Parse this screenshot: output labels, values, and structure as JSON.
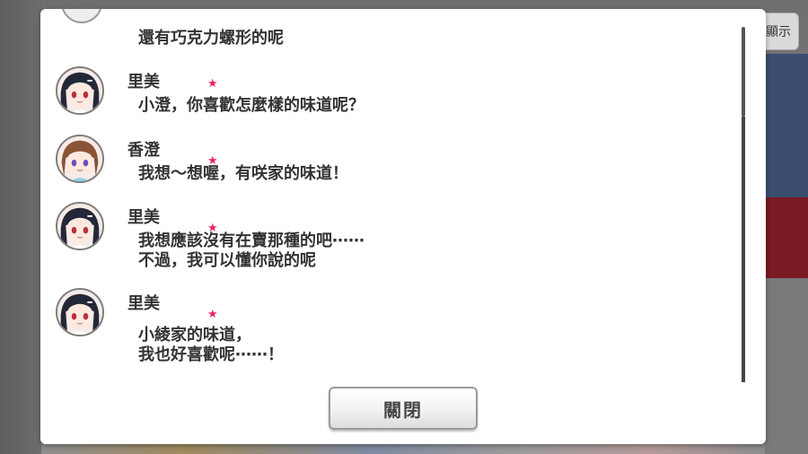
{
  "hint_button": {
    "label": "顯示"
  },
  "dialog": {
    "entries": [
      {
        "speaker": "",
        "lines": [
          "還有巧克力螺形的呢"
        ],
        "avatar": "partial-avatar"
      },
      {
        "speaker": "里美",
        "lines": [
          "小澄，你喜歡怎麼樣的味道呢？"
        ],
        "avatar": "rimi-avatar",
        "star": "★"
      },
      {
        "speaker": "香澄",
        "lines": [
          "我想～想喔，有咲家的味道！"
        ],
        "avatar": "kasumi-avatar",
        "star": "★"
      },
      {
        "speaker": "里美",
        "lines": [
          "我想應該沒有在賣那種的吧⋯⋯",
          "不過，我可以懂你說的呢"
        ],
        "avatar": "rimi-avatar",
        "star": "★"
      },
      {
        "speaker": "里美",
        "lines": [
          "小綾家的味道，",
          "我也好喜歡呢⋯⋯！"
        ],
        "avatar": "rimi-avatar",
        "star": "★"
      }
    ],
    "close_label": "關閉"
  },
  "colors": {
    "star": "#e8245a",
    "text": "#333333",
    "panel": "#ffffff"
  }
}
